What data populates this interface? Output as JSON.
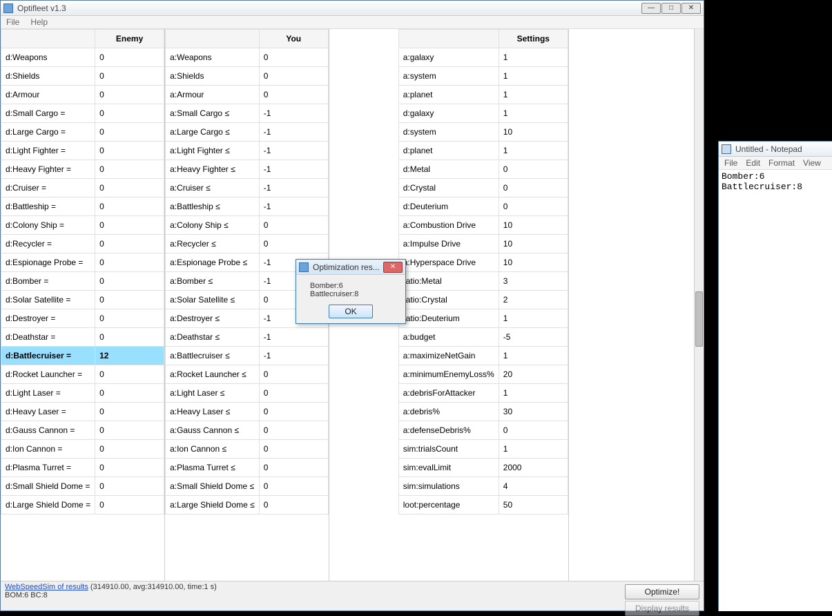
{
  "mainWindow": {
    "title": "Optifleet v1.3",
    "menu": {
      "file": "File",
      "help": "Help"
    },
    "controls": {
      "min": "—",
      "max": "□",
      "close": "✕"
    }
  },
  "enemy": {
    "header": "Enemy",
    "rows": [
      {
        "label": "d:Weapons",
        "value": "0"
      },
      {
        "label": "d:Shields",
        "value": "0"
      },
      {
        "label": "d:Armour",
        "value": "0"
      },
      {
        "label": "d:Small Cargo =",
        "value": "0"
      },
      {
        "label": "d:Large Cargo =",
        "value": "0"
      },
      {
        "label": "d:Light Fighter =",
        "value": "0"
      },
      {
        "label": "d:Heavy Fighter =",
        "value": "0"
      },
      {
        "label": "d:Cruiser =",
        "value": "0"
      },
      {
        "label": "d:Battleship =",
        "value": "0"
      },
      {
        "label": "d:Colony Ship =",
        "value": "0"
      },
      {
        "label": "d:Recycler =",
        "value": "0"
      },
      {
        "label": "d:Espionage Probe =",
        "value": "0"
      },
      {
        "label": "d:Bomber =",
        "value": "0"
      },
      {
        "label": "d:Solar Satellite =",
        "value": "0"
      },
      {
        "label": "d:Destroyer =",
        "value": "0"
      },
      {
        "label": "d:Deathstar =",
        "value": "0"
      },
      {
        "label": "d:Battlecruiser =",
        "value": "12",
        "selected": true
      },
      {
        "label": "d:Rocket Launcher =",
        "value": "0"
      },
      {
        "label": "d:Light Laser =",
        "value": "0"
      },
      {
        "label": "d:Heavy Laser =",
        "value": "0"
      },
      {
        "label": "d:Gauss Cannon =",
        "value": "0"
      },
      {
        "label": "d:Ion Cannon =",
        "value": "0"
      },
      {
        "label": "d:Plasma Turret =",
        "value": "0"
      },
      {
        "label": "d:Small Shield Dome =",
        "value": "0"
      },
      {
        "label": "d:Large Shield Dome =",
        "value": "0"
      }
    ]
  },
  "you": {
    "header": "You",
    "rows": [
      {
        "label": "a:Weapons",
        "value": "0"
      },
      {
        "label": "a:Shields",
        "value": "0"
      },
      {
        "label": "a:Armour",
        "value": "0"
      },
      {
        "label": "a:Small Cargo ≤",
        "value": "-1"
      },
      {
        "label": "a:Large Cargo ≤",
        "value": "-1"
      },
      {
        "label": "a:Light Fighter ≤",
        "value": "-1"
      },
      {
        "label": "a:Heavy Fighter ≤",
        "value": "-1"
      },
      {
        "label": "a:Cruiser ≤",
        "value": "-1"
      },
      {
        "label": "a:Battleship ≤",
        "value": "-1"
      },
      {
        "label": "a:Colony Ship ≤",
        "value": "0"
      },
      {
        "label": "a:Recycler ≤",
        "value": "0"
      },
      {
        "label": "a:Espionage Probe ≤",
        "value": "-1"
      },
      {
        "label": "a:Bomber ≤",
        "value": "-1"
      },
      {
        "label": "a:Solar Satellite ≤",
        "value": "0"
      },
      {
        "label": "a:Destroyer ≤",
        "value": "-1"
      },
      {
        "label": "a:Deathstar ≤",
        "value": "-1"
      },
      {
        "label": "a:Battlecruiser ≤",
        "value": "-1"
      },
      {
        "label": "a:Rocket Launcher ≤",
        "value": "0"
      },
      {
        "label": "a:Light Laser ≤",
        "value": "0"
      },
      {
        "label": "a:Heavy Laser ≤",
        "value": "0"
      },
      {
        "label": "a:Gauss Cannon ≤",
        "value": "0"
      },
      {
        "label": "a:Ion Cannon ≤",
        "value": "0"
      },
      {
        "label": "a:Plasma Turret ≤",
        "value": "0"
      },
      {
        "label": "a:Small Shield Dome ≤",
        "value": "0"
      },
      {
        "label": "a:Large Shield Dome ≤",
        "value": "0"
      }
    ]
  },
  "settings": {
    "header": "Settings",
    "rows": [
      {
        "label": "a:galaxy",
        "value": "1"
      },
      {
        "label": "a:system",
        "value": "1"
      },
      {
        "label": "a:planet",
        "value": "1"
      },
      {
        "label": "d:galaxy",
        "value": "1"
      },
      {
        "label": "d:system",
        "value": "10"
      },
      {
        "label": "d:planet",
        "value": "1"
      },
      {
        "label": "d:Metal",
        "value": "0"
      },
      {
        "label": "d:Crystal",
        "value": "0"
      },
      {
        "label": "d:Deuterium",
        "value": "0"
      },
      {
        "label": "a:Combustion Drive",
        "value": "10"
      },
      {
        "label": "a:Impulse Drive",
        "value": "10"
      },
      {
        "label": "a:Hyperspace Drive",
        "value": "10"
      },
      {
        "label": "ratio:Metal",
        "value": "3"
      },
      {
        "label": "ratio:Crystal",
        "value": "2"
      },
      {
        "label": "ratio:Deuterium",
        "value": "1"
      },
      {
        "label": "a:budget",
        "value": "-5"
      },
      {
        "label": "a:maximizeNetGain",
        "value": "1"
      },
      {
        "label": "a:minimumEnemyLoss%",
        "value": "20"
      },
      {
        "label": "a:debrisForAttacker",
        "value": "1"
      },
      {
        "label": "a:debris%",
        "value": "30"
      },
      {
        "label": "a:defenseDebris%",
        "value": "0"
      },
      {
        "label": "sim:trialsCount",
        "value": "1"
      },
      {
        "label": "sim:evalLimit",
        "value": "2000"
      },
      {
        "label": "sim:simulations",
        "value": "4"
      },
      {
        "label": "loot:percentage",
        "value": "50"
      }
    ]
  },
  "footer": {
    "link": "WebSpeedSim of results",
    "stats": " (314910.00, avg:314910.00, time:1 s)",
    "summary": "BOM:6 BC:8",
    "optimizeBtn": "Optimize!",
    "displayBtn": "Display results"
  },
  "dialog": {
    "title": "Optimization res...",
    "line1": "Bomber:6",
    "line2": "Battlecruiser:8",
    "ok": "OK"
  },
  "notepad": {
    "title": "Untitled - Notepad",
    "menu": {
      "file": "File",
      "edit": "Edit",
      "format": "Format",
      "view": "View"
    },
    "content": "Bomber:6\nBattlecruiser:8"
  }
}
